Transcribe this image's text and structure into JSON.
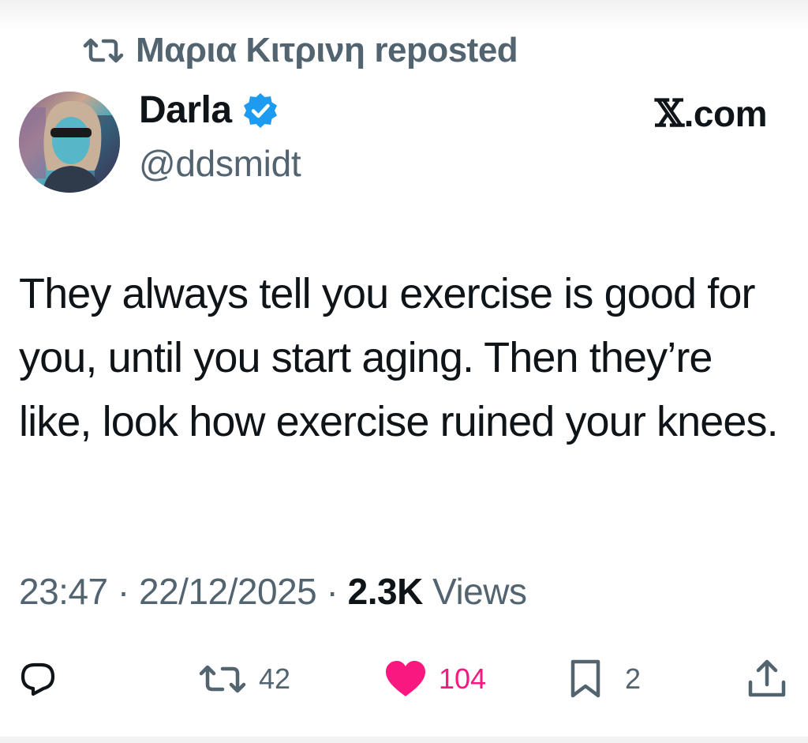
{
  "repost": {
    "reposter_name": "Μαρια Κιτρινη",
    "suffix": "reposted"
  },
  "author": {
    "name": "Darla",
    "handle": "@ddsmidt",
    "verified": true,
    "avatar_icon": "profile-photo"
  },
  "source": {
    "x_logo": "𝕏",
    "domain": ".com"
  },
  "tweet": {
    "text": "They always tell you exercise is good for you, until you start aging. Then they’re like, look how exercise ruined your knees."
  },
  "meta": {
    "time": "23:47",
    "separator": "·",
    "date": "22/12/2025",
    "views_count": "2.3K",
    "views_label": "Views"
  },
  "actions": {
    "reply": {
      "icon": "reply-bubble-icon"
    },
    "repost": {
      "icon": "repost-icon",
      "count": "42"
    },
    "like": {
      "icon": "heart-icon",
      "count": "104",
      "liked": true
    },
    "bookmark": {
      "icon": "bookmark-icon",
      "count": "2"
    },
    "share": {
      "icon": "share-icon"
    }
  },
  "colors": {
    "text": "#0f1419",
    "secondary": "#536471",
    "like": "#f91880",
    "verified": "#1d9bf0"
  }
}
